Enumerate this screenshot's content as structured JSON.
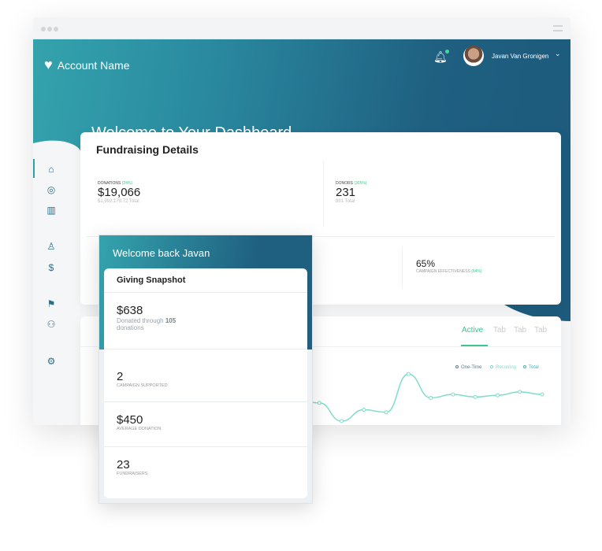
{
  "header": {
    "account_name": "Account Name",
    "welcome": "Welcome  to Your Dashboard",
    "user_name": "Javan Van Gronigen"
  },
  "sidebar": {
    "icons": [
      "home-icon",
      "check-circle-icon",
      "bar-chart-icon",
      "user-icon",
      "dollar-icon",
      "flag-icon",
      "users-icon",
      "gear-icon"
    ],
    "active": "home-icon"
  },
  "fundraising": {
    "title": "Fundraising Details",
    "donations": {
      "label": "Donations",
      "change": "(24%)",
      "value": "$19,066",
      "total": "$1,992,179.72 Total"
    },
    "donors": {
      "label": "Donors",
      "change": "(305%)",
      "value": "231",
      "total": "891 Total"
    },
    "effectiveness": {
      "value": "65%",
      "label": "Campaign Effectiveness",
      "change": "(64%)"
    }
  },
  "chart_card": {
    "tabs": [
      "Active",
      "Tab",
      "Tab",
      "Tab"
    ],
    "legend": [
      "One-Time",
      "Recurring",
      "Total"
    ],
    "colors": {
      "one_time": "#5b7f93",
      "recurring": "#7fdccb",
      "total": "#4ab1b6"
    }
  },
  "chart_data": {
    "type": "line",
    "series": [
      {
        "values": [
          3,
          2.6,
          0,
          1.8,
          1.5,
          6,
          3.2,
          3.6,
          3.3,
          3.5,
          3.9,
          3.6
        ]
      }
    ]
  },
  "popup": {
    "title": "Welcome back Javan",
    "snapshot_title": "Giving Snapshot",
    "donated": {
      "value": "$638",
      "desc_prefix": "Donated through",
      "count": "105",
      "desc_suffix": "donations"
    },
    "items": [
      {
        "value": "2",
        "label": "Campaign Supported"
      },
      {
        "value": "$450",
        "label": "Average Donation"
      },
      {
        "value": "23",
        "label": "Fundraisers"
      }
    ]
  }
}
